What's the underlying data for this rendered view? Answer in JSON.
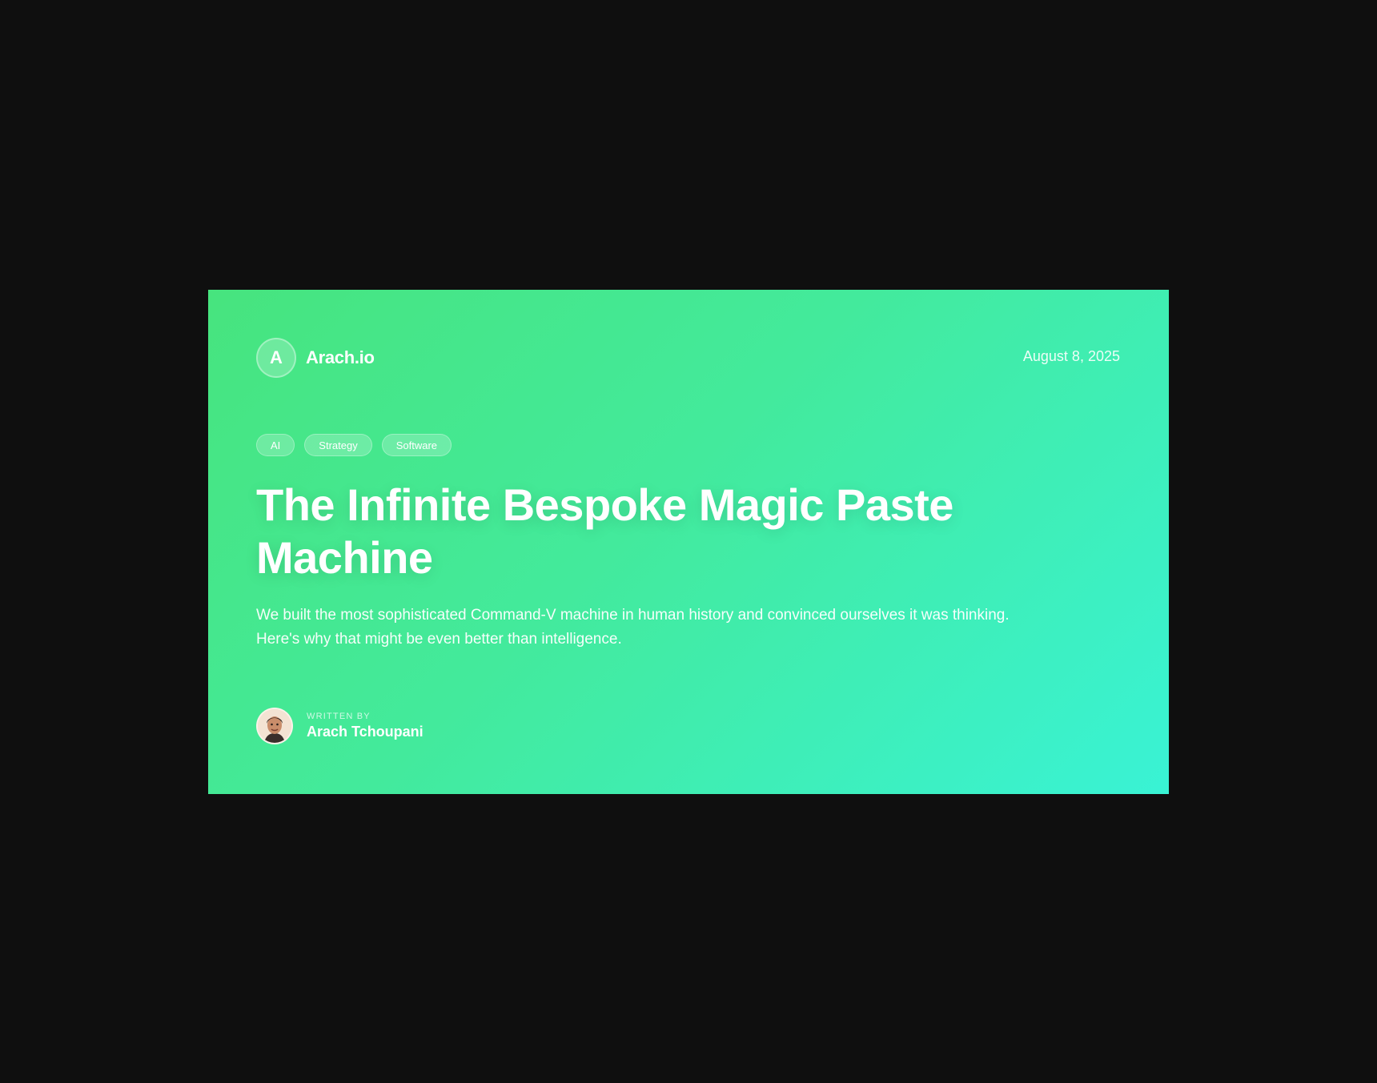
{
  "brand": {
    "initial": "A",
    "name": "Arach.io"
  },
  "post": {
    "date": "August 8, 2025",
    "tags": [
      "AI",
      "Strategy",
      "Software"
    ],
    "title": "The Infinite Bespoke Magic Paste Machine",
    "subtitle": "We built the most sophisticated Command-V machine in human history and convinced ourselves it was thinking. Here's why that might be even better than intelligence."
  },
  "author": {
    "label": "WRITTEN BY",
    "name": "Arach Tchoupani",
    "avatar_icon": "author-avatar-photo"
  },
  "colors": {
    "page_background": "#0f0f0f",
    "gradient_start": "#47e47e",
    "gradient_end": "#39f3d5",
    "text": "#ffffff"
  }
}
